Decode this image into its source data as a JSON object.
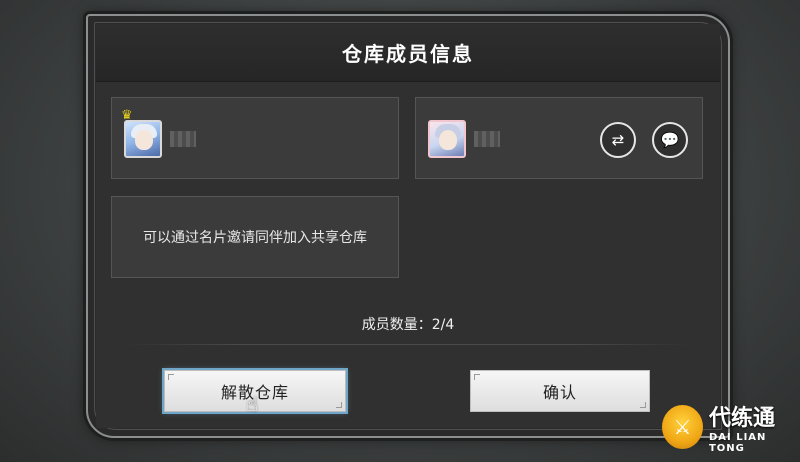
{
  "dialog": {
    "title": "仓库成员信息",
    "members": [
      {
        "avatar": "avatar-white-hair",
        "is_owner": true,
        "owner_icon": "crown-icon"
      },
      {
        "avatar": "avatar-cat-ears",
        "is_owner": false,
        "actions": [
          "transfer-icon",
          "chat-icon"
        ]
      }
    ],
    "invite_hint": "可以通过名片邀请同伴加入共享仓库",
    "member_count_text": "成员数量：2/4",
    "buttons": {
      "dissolve": "解散仓库",
      "confirm": "确认"
    }
  },
  "watermark": {
    "main": "代练通",
    "sub": "DAI LIAN TONG"
  },
  "colors": {
    "dialog_bg": "#2a2a2a",
    "card_bg": "#3b3b3b",
    "button_bg": "#efefef",
    "focus_glow": "#6fa6c8",
    "owner_crown": "#e7d11e"
  }
}
